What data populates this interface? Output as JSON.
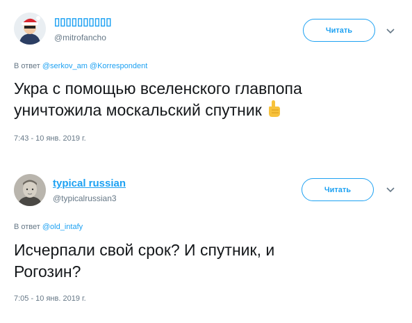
{
  "tweets": [
    {
      "display_name": "▯▯▯▯▯▯▯▯▯▯",
      "handle": "@mitrofancho",
      "follow_label": "Читать",
      "reply_prefix": "В ответ",
      "reply_mentions": [
        "@serkov_am",
        "@Korrespondent"
      ],
      "text_line1": "Укра с помощью вселенского главпопа",
      "text_line2": "уничтожила москальский спутник",
      "emoji": "pointing-up-icon",
      "timestamp": "7:43 - 10 янв. 2019 г."
    },
    {
      "display_name": "typical russian",
      "handle": "@typicalrussian3",
      "follow_label": "Читать",
      "reply_prefix": "В ответ",
      "reply_mentions": [
        "@old_intafy"
      ],
      "text_line1": "Исчерпали свой срок? И спутник, и",
      "text_line2": "Рогозин?",
      "timestamp": "7:05 - 10 янв. 2019 г."
    }
  ],
  "colors": {
    "accent": "#1da1f2",
    "text": "#14171a",
    "secondary": "#657786"
  }
}
